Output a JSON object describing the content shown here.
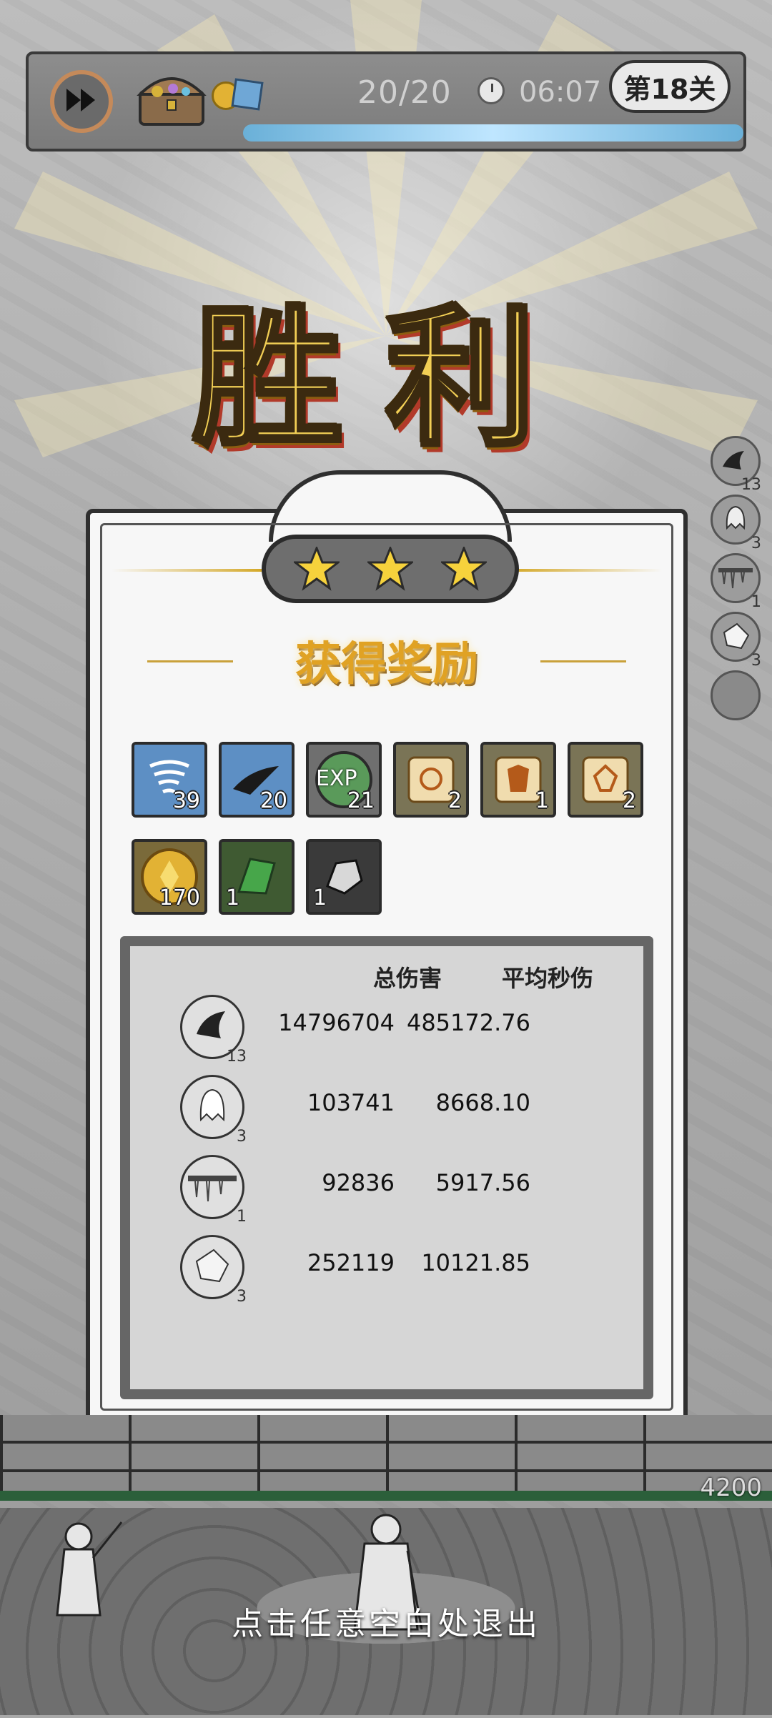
{
  "topbar": {
    "wave": "20/20",
    "time": "06:07",
    "level": "第18关",
    "speed_icon": "fast-forward-icon",
    "chest_icon": "treasure-chest-icon",
    "wave_progress": 1.0
  },
  "victory_title": "胜利",
  "side_skills": [
    {
      "icon": "ink-splash-skill-icon",
      "count": "13"
    },
    {
      "icon": "ghost-skill-icon",
      "count": "3"
    },
    {
      "icon": "icicle-skill-icon",
      "count": "1"
    },
    {
      "icon": "shield-skill-icon",
      "count": "3"
    },
    {
      "icon": "empty-slot-icon",
      "count": ""
    }
  ],
  "panel": {
    "stars": 3,
    "reward_title": "获得奖励",
    "rewards": [
      {
        "icon": "tornado-card-icon",
        "count": "39"
      },
      {
        "icon": "ink-card-icon",
        "count": "20"
      },
      {
        "icon": "exp-orb-icon",
        "label": "EXP",
        "count": "21"
      },
      {
        "icon": "scroll-necklace-icon",
        "count": "2"
      },
      {
        "icon": "scroll-armor-icon",
        "count": "1"
      },
      {
        "icon": "scroll-gem-icon",
        "count": "2"
      },
      {
        "icon": "gold-coin-icon",
        "count": "170"
      },
      {
        "icon": "green-crystal-icon",
        "count": "1"
      },
      {
        "icon": "silver-ore-icon",
        "count": "1"
      }
    ],
    "stats": {
      "header_total": "总伤害",
      "header_dps": "平均秒伤",
      "rows": [
        {
          "icon": "ink-splash-skill-icon",
          "level": "13",
          "total": "14796704",
          "dps": "485172.76"
        },
        {
          "icon": "ghost-skill-icon",
          "level": "3",
          "total": "103741",
          "dps": "8668.10"
        },
        {
          "icon": "icicle-skill-icon",
          "level": "1",
          "total": "92836",
          "dps": "5917.56"
        },
        {
          "icon": "shield-skill-icon",
          "level": "3",
          "total": "252119",
          "dps": "10121.85"
        }
      ]
    }
  },
  "wall_hp": "4200",
  "exit_hint": "点击任意空白处退出",
  "colors": {
    "gold": "#f2cf55",
    "panel_bg": "#f7f7f7",
    "hp_green": "#2b5f3a"
  }
}
